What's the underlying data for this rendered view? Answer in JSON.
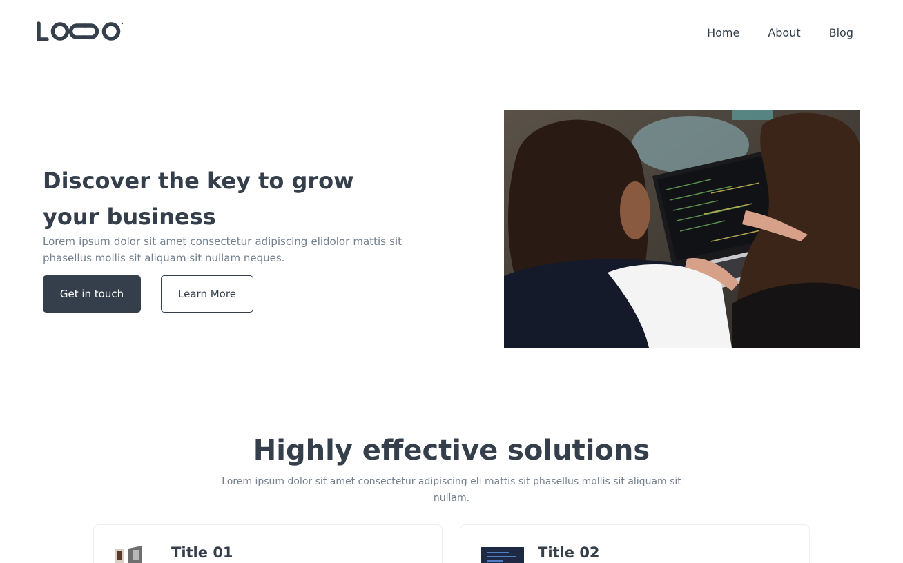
{
  "header": {
    "logo_text": "LOGO",
    "nav": [
      "Home",
      "About",
      "Blog"
    ]
  },
  "hero": {
    "title": "Discover the key to grow your business",
    "description": "Lorem ipsum dolor sit amet consectetur adipiscing elidolor mattis sit phasellus mollis sit aliquam sit nullam neques.",
    "primary_button": "Get in touch",
    "secondary_button": "Learn More",
    "image_icon": "photo-two-women-laptop"
  },
  "solutions": {
    "title": "Highly effective solutions",
    "description": "Lorem ipsum dolor sit amet consectetur adipiscing eli mattis sit phasellus mollis sit aliquam sit nullam.",
    "cards": [
      {
        "title": "Title 01",
        "thumb_icon": "photo-thumbnail"
      },
      {
        "title": "Title 02",
        "thumb_icon": "photo-thumbnail"
      }
    ]
  },
  "colors": {
    "primary": "#343f4b",
    "muted": "#717f8e"
  }
}
